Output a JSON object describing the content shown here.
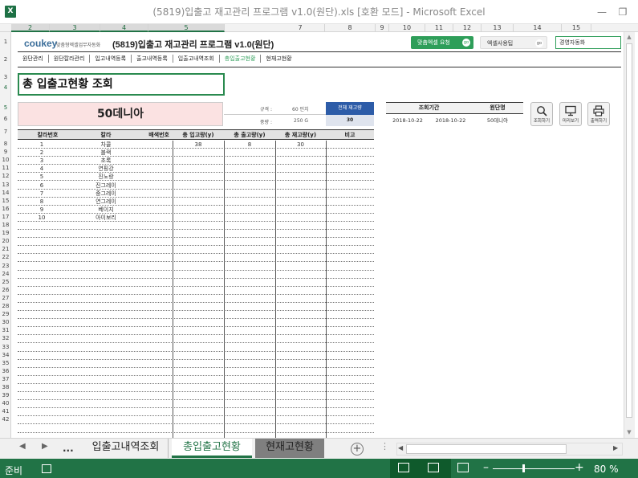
{
  "window": {
    "title": "(5819)입출고 재고관리 프로그램 v1.0(원단).xls  [호환 모드] - Microsoft Excel",
    "app_icon": "X"
  },
  "columns": [
    "2",
    "3",
    "4",
    "5",
    "7",
    "8",
    "9",
    "10",
    "11",
    "12",
    "13",
    "14",
    "15"
  ],
  "rows": [
    "1",
    "2",
    "3",
    "4",
    "5",
    "6",
    "7",
    "8",
    "9",
    "10",
    "11",
    "12",
    "13",
    "14",
    "15",
    "16",
    "17",
    "18",
    "19",
    "20",
    "21",
    "22",
    "23",
    "24",
    "25",
    "26",
    "27",
    "28",
    "29",
    "30",
    "31",
    "32",
    "33",
    "34",
    "35",
    "36",
    "37",
    "38",
    "39",
    "40",
    "41",
    "42"
  ],
  "header": {
    "brand": "coukey",
    "brand_tagline": "맞춤형엑셀업무자동화",
    "app_title": "(5819)입출고 재고관리 프로그램 v1.0(원단)",
    "btn_custom": "맞춤엑셀 요청",
    "btn_tips": "엑셀사용팁",
    "go": "go",
    "company": "경영자동화"
  },
  "nav": [
    "원단관리",
    "원단칼라관리",
    "입고내역등록",
    "출고내역등록",
    "입출고내역조회",
    "총입출고현황",
    "현재고현황"
  ],
  "page_title": "총 입출고현황 조회",
  "fabric": {
    "name": "50데니아",
    "spec_label": "규격 :",
    "spec_value": "60 인치",
    "weight_label": "중량 :",
    "weight_value": "250 G",
    "total_label": "전체 재고량",
    "total_value": "30"
  },
  "query": {
    "headers": [
      "조회기간",
      "원단명"
    ],
    "start": "2018-10-22",
    "end": "2018-10-22",
    "fabric": "50데니아"
  },
  "icon_buttons": [
    {
      "label": "조회하기",
      "icon": "search-icon"
    },
    {
      "label": "미리보기",
      "icon": "monitor-icon"
    },
    {
      "label": "출력하기",
      "icon": "printer-icon"
    }
  ],
  "grid": {
    "headers": [
      "칼라번호",
      "칼라",
      "배색번호",
      "총 입고량(y)",
      "총 출고량(y)",
      "총 재고량(y)",
      "비고"
    ],
    "rows": [
      [
        "1",
        "차콜",
        "",
        "38",
        "8",
        "30",
        ""
      ],
      [
        "2",
        "블랙",
        "",
        "",
        "",
        "",
        ""
      ],
      [
        "3",
        "초록",
        "",
        "",
        "",
        "",
        ""
      ],
      [
        "4",
        "연핑강",
        "",
        "",
        "",
        "",
        ""
      ],
      [
        "5",
        "진노랑",
        "",
        "",
        "",
        "",
        ""
      ],
      [
        "6",
        "진그레이",
        "",
        "",
        "",
        "",
        ""
      ],
      [
        "7",
        "중그레이",
        "",
        "",
        "",
        "",
        ""
      ],
      [
        "8",
        "연그레이",
        "",
        "",
        "",
        "",
        ""
      ],
      [
        "9",
        "베이지",
        "",
        "",
        "",
        "",
        ""
      ],
      [
        "10",
        "아이보리",
        "",
        "",
        "",
        "",
        ""
      ]
    ]
  },
  "tabs": [
    "입출고내역조회",
    "총입출고현황",
    "현재고현황"
  ],
  "tab_ellipsis": "...",
  "status": {
    "ready": "준비",
    "zoom": "80 %"
  }
}
